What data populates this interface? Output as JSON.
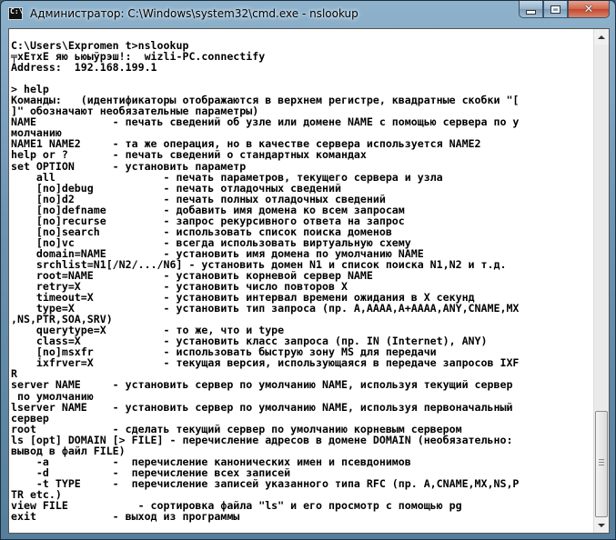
{
  "window": {
    "title": "Администратор: C:\\Windows\\system32\\cmd.exe - nslookup",
    "app_icon_text": "C:\\",
    "controls": {
      "minimize": "minimize",
      "maximize": "maximize",
      "close": "✕"
    }
  },
  "console": {
    "background": "#ffffff",
    "text_color": "#000000",
    "lines": [
      "C:\\Users\\Expromen t>nslookup",
      "╤xEтxE яю ьюыўрэш!:  wizli-PC.connectify",
      "Address:  192.168.199.1",
      "",
      "> help",
      "Команды:   (идентификаторы отображаются в верхнем регистре, квадратные скобки \"[",
      "]\" обозначают необязательные параметры)",
      "NAME            - печать сведений об узле или домене NAME с помощью сервера по у",
      "молчанию",
      "NAME1 NAME2     - та же операция, но в качестве сервера используется NAME2",
      "help or ?       - печать сведений о стандартных командах",
      "set OPTION      - установить параметр",
      "    all                 - печать параметров, текущего сервера и узла",
      "    [no]debug           - печать отладочных сведений",
      "    [no]d2              - печать полных отладочных сведений",
      "    [no]defname         - добавить имя домена ко всем запросам",
      "    [no]recurse         - запрос рекурсивного ответа на запрос",
      "    [no]search          - использовать список поиска доменов",
      "    [no]vc              - всегда использовать виртуальную схему",
      "    domain=NAME         - установить имя домена по умолчанию NAME",
      "    srchlist=N1[/N2/.../N6] - установить домен N1 и список поиска N1,N2 и т.д.",
      "    root=NAME           - установить корневой сервер NAME",
      "    retry=X             - установить число повторов X",
      "    timeout=X           - установить интервал времени ожидания в X секунд",
      "    type=X              - установить тип запроса (пр. A,AAAA,A+AAAA,ANY,CNAME,MX",
      ",NS,PTR,SOA,SRV)",
      "    querytype=X         - то же, что и type",
      "    class=X             - установить класс запроса (пр. IN (Internet), ANY)",
      "    [no]msxfr           - использовать быструю зону MS для передачи",
      "    ixfrver=X           - текущая версия, использующаяся в передаче запросов IXF",
      "R",
      "server NAME     - установить сервер по умолчанию NAME, используя текущий сервер",
      " по умолчанию",
      "lserver NAME    - установить сервер по умолчанию NAME, используя первоначальный",
      "сервер",
      "root            - сделать текущий сервер по умолчанию корневым сервером",
      "ls [opt] DOMAIN [> FILE] - перечисление адресов в домене DOMAIN (необязательно:",
      "вывод в файл FILE)",
      "    -a          -  перечисление канонических имен и псевдонимов",
      "    -d          -  перечисление всех записей",
      "    -t TYPE     -  перечисление записей указанного типа RFC (пр. A,CNAME,MX,NS,P",
      "TR etc.)",
      "view FILE           - сортировка файла \"ls\" и его просмотр с помощью pg",
      "exit            - выход из программы"
    ]
  }
}
